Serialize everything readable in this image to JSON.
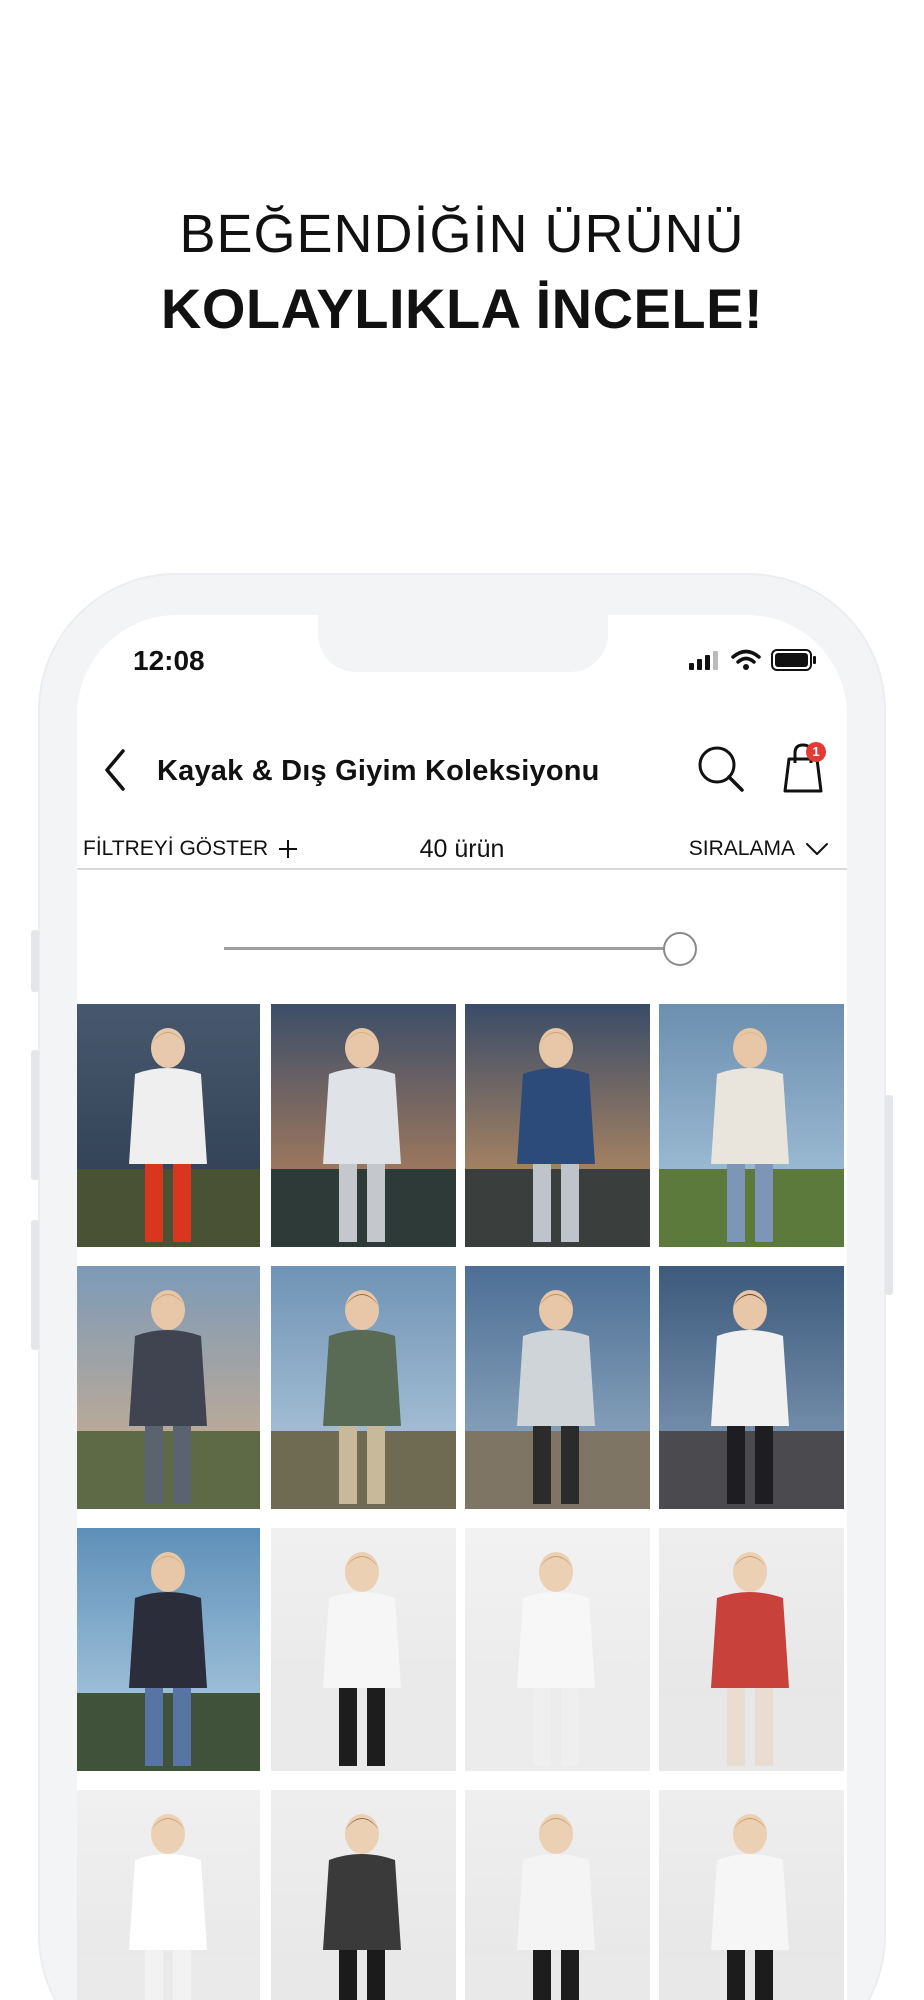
{
  "headline": {
    "line1": "BEĞENDİĞİN ÜRÜNÜ",
    "line2": "KOLAYLIKLA İNCELE!"
  },
  "status_bar": {
    "time": "12:08"
  },
  "nav": {
    "title": "Kayak & Dış Giyim Koleksiyonu",
    "back_icon": "chevron-left-icon",
    "search_icon": "search-icon",
    "bag_icon": "shopping-bag-icon",
    "bag_badge": "1"
  },
  "filter_bar": {
    "filter_label": "FİLTREYİ GÖSTER",
    "count_label": "40 ürün",
    "sort_label": "SIRALAMA"
  },
  "grid_slider": {
    "value": 1.0
  },
  "colors": {
    "badge": "#e53935",
    "frame": "#f3f4f6",
    "divider": "#d9d9d9"
  },
  "products": [
    {
      "name": "ski-red-jumpsuit-photo"
    },
    {
      "name": "silver-puffer-jacket-photo"
    },
    {
      "name": "silver-puffer-blue-photo"
    },
    {
      "name": "striped-cardigan-swing-photo"
    },
    {
      "name": "grey-coat-reeds-photo"
    },
    {
      "name": "couple-lake-photo"
    },
    {
      "name": "grey-jacket-boat-photo"
    },
    {
      "name": "sweatshirt-dog-photo"
    },
    {
      "name": "striped-cardigan-jeans-photo"
    },
    {
      "name": "black-white-sweater-photo"
    },
    {
      "name": "white-ski-suit-photo"
    },
    {
      "name": "red-pattern-sweater-photo"
    },
    {
      "name": "white-pants-ski-photo"
    },
    {
      "name": "patterned-jacket-poles-photo"
    },
    {
      "name": "white-jacket-camera-photo"
    },
    {
      "name": "white-vest-photo"
    }
  ]
}
